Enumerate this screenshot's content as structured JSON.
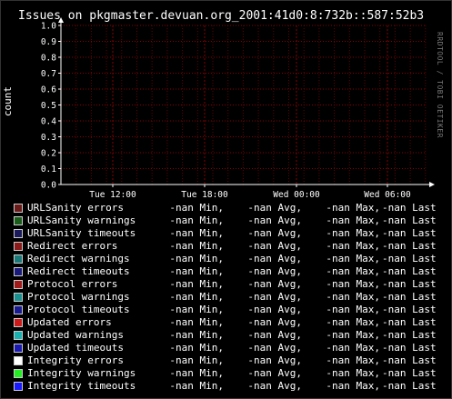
{
  "title": "Issues on pkgmaster.devuan.org_2001:41d0:8:732b::587:52b3",
  "watermark": "RRDTOOL / TOBI OETIKER",
  "colors": {
    "background": "#000000",
    "grid": "#8b0000",
    "axis": "#ffffff",
    "text": "#ffffff"
  },
  "chart_data": {
    "type": "line",
    "ylabel": "count",
    "ylim": [
      0.0,
      1.0
    ],
    "yticks": [
      "0.0",
      "0.1",
      "0.2",
      "0.3",
      "0.4",
      "0.5",
      "0.6",
      "0.7",
      "0.8",
      "0.9",
      "1.0"
    ],
    "xticks": [
      "Tue 12:00",
      "Tue 18:00",
      "Wed 00:00",
      "Wed 06:00"
    ],
    "grid": true,
    "series": []
  },
  "legend": [
    {
      "name": "URLSanity errors",
      "color": "#6b1a1a",
      "min": "-nan Min,",
      "avg": "-nan Avg,",
      "max": "-nan Max,",
      "last": "-nan Last"
    },
    {
      "name": "URLSanity warnings",
      "color": "#1a5c1a",
      "min": "-nan Min,",
      "avg": "-nan Avg,",
      "max": "-nan Max,",
      "last": "-nan Last"
    },
    {
      "name": "URLSanity timeouts",
      "color": "#1a1a5c",
      "min": "-nan Min,",
      "avg": "-nan Avg,",
      "max": "-nan Max,",
      "last": "-nan Last"
    },
    {
      "name": "Redirect errors",
      "color": "#8b1a1a",
      "min": "-nan Min,",
      "avg": "-nan Avg,",
      "max": "-nan Max,",
      "last": "-nan Last"
    },
    {
      "name": "Redirect warnings",
      "color": "#1a7a7a",
      "min": "-nan Min,",
      "avg": "-nan Avg,",
      "max": "-nan Max,",
      "last": "-nan Last"
    },
    {
      "name": "Redirect timeouts",
      "color": "#1a1a7a",
      "min": "-nan Min,",
      "avg": "-nan Avg,",
      "max": "-nan Max,",
      "last": "-nan Last"
    },
    {
      "name": "Protocol errors",
      "color": "#a01a1a",
      "min": "-nan Min,",
      "avg": "-nan Avg,",
      "max": "-nan Max,",
      "last": "-nan Last"
    },
    {
      "name": "Protocol warnings",
      "color": "#1a9090",
      "min": "-nan Min,",
      "avg": "-nan Avg,",
      "max": "-nan Max,",
      "last": "-nan Last"
    },
    {
      "name": "Protocol timeouts",
      "color": "#1a1a90",
      "min": "-nan Min,",
      "avg": "-nan Avg,",
      "max": "-nan Max,",
      "last": "-nan Last"
    },
    {
      "name": "Updated errors",
      "color": "#cc1a1a",
      "min": "-nan Min,",
      "avg": "-nan Avg,",
      "max": "-nan Max,",
      "last": "-nan Last"
    },
    {
      "name": "Updated warnings",
      "color": "#1ab0b0",
      "min": "-nan Min,",
      "avg": "-nan Avg,",
      "max": "-nan Max,",
      "last": "-nan Last"
    },
    {
      "name": "Updated timeouts",
      "color": "#1a1ab0",
      "min": "-nan Min,",
      "avg": "-nan Avg,",
      "max": "-nan Max,",
      "last": "-nan Last"
    },
    {
      "name": "Integrity errors",
      "color": "#ffffff",
      "min": "-nan Min,",
      "avg": "-nan Avg,",
      "max": "-nan Max,",
      "last": "-nan Last"
    },
    {
      "name": "Integrity warnings",
      "color": "#22ee22",
      "min": "-nan Min,",
      "avg": "-nan Avg,",
      "max": "-nan Max,",
      "last": "-nan Last"
    },
    {
      "name": "Integrity timeouts",
      "color": "#1a1aff",
      "min": "-nan Min,",
      "avg": "-nan Avg,",
      "max": "-nan Max,",
      "last": "-nan Last"
    }
  ]
}
